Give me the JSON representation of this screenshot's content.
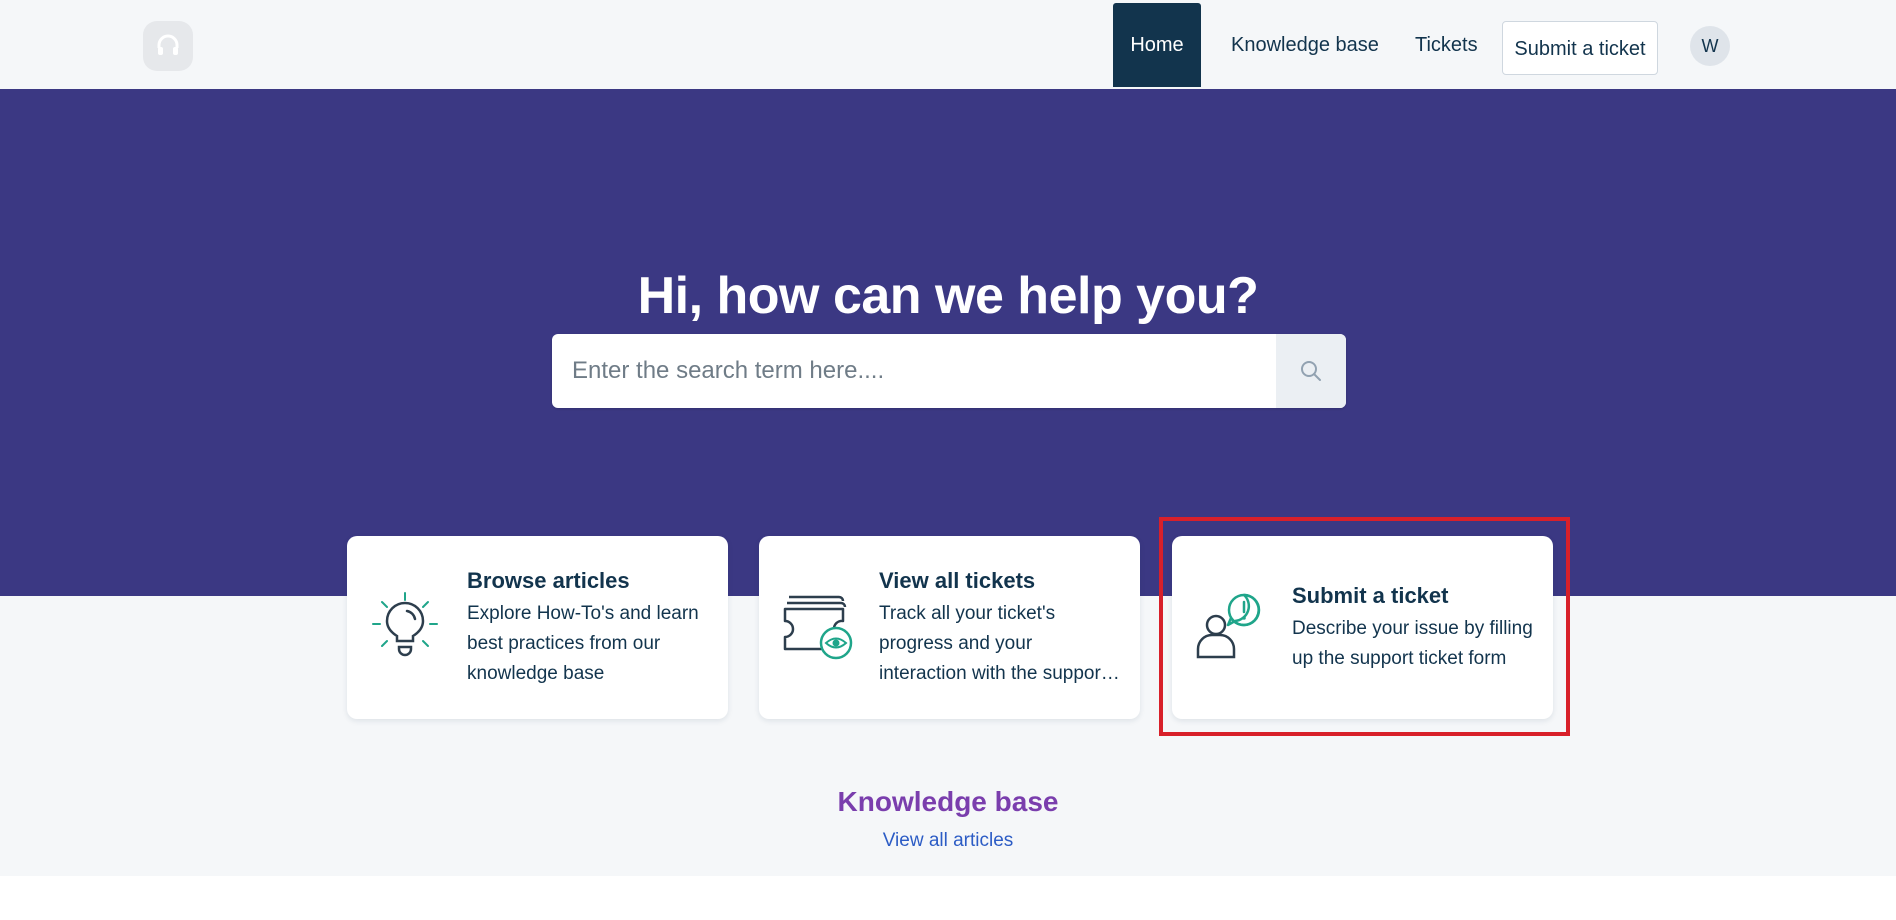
{
  "header": {
    "nav": {
      "home": "Home",
      "knowledge_base": "Knowledge base",
      "tickets": "Tickets",
      "submit_ticket": "Submit a ticket"
    },
    "avatar_initial": "W"
  },
  "hero": {
    "title": "Hi, how can we help you?",
    "search": {
      "placeholder": "Enter the search term here....",
      "value": ""
    }
  },
  "cards": [
    {
      "title": "Browse articles",
      "description": "Explore How-To's and learn best practices from our knowledge base",
      "icon": "lightbulb-icon"
    },
    {
      "title": "View all tickets",
      "description_lines": [
        "Track all your ticket's",
        "progress and your",
        "interaction with the support team"
      ],
      "icon": "tickets-eye-icon"
    },
    {
      "title": "Submit a ticket",
      "description": "Describe your issue by filling up the support ticket form",
      "icon": "user-alert-icon"
    }
  ],
  "knowledge_base": {
    "title": "Knowledge base",
    "link": "View all articles"
  },
  "colors": {
    "hero_bg": "#3b3883",
    "nav_active": "#12344d",
    "accent_green": "#1fa58a",
    "kb_title": "#7a3ead",
    "link": "#2c5cc5",
    "highlight": "#d8202a"
  }
}
